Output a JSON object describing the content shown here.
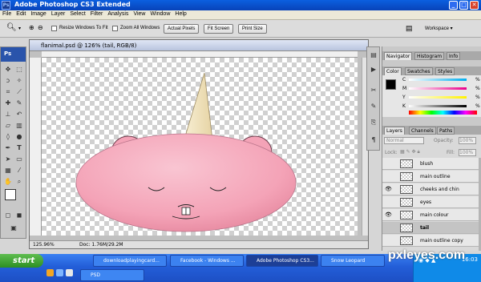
{
  "window": {
    "app_icon_text": "Ps",
    "title": "Adobe Photoshop CS3 Extended",
    "controls": [
      "_",
      "□",
      "✕"
    ]
  },
  "menubar": {
    "items": [
      "File",
      "Edit",
      "Image",
      "Layer",
      "Select",
      "Filter",
      "Analysis",
      "View",
      "Window",
      "Help"
    ]
  },
  "options": {
    "resize_windows_label": "Resize Windows To Fit",
    "zoom_all_label": "Zoom All Windows",
    "actual_pixels": "Actual Pixels",
    "fit_screen": "Fit Screen",
    "print_size": "Print Size",
    "workspace": "Workspace ▾"
  },
  "toolbox": {
    "header": "Ps"
  },
  "document": {
    "title": "flanimal.psd @ 126% (tail, RGB/8)",
    "zoom": "125.96%",
    "doc_info": "Doc: 1.76M/29.2M"
  },
  "panels": {
    "top_tabs": [
      "Navigator",
      "Histogram",
      "Info"
    ],
    "color_tabs": [
      "Color",
      "Swatches",
      "Styles"
    ],
    "color_channels": [
      "C",
      "M",
      "Y",
      "K"
    ],
    "percent": "%",
    "layers_tabs": [
      "Layers",
      "Channels",
      "Paths"
    ],
    "blend_mode": "Normal",
    "opacity_label": "Opacity:",
    "opacity": "100%",
    "lock_label": "Lock:",
    "fill_label": "Fill:",
    "fill": "100%",
    "layers": [
      "blush",
      "main outline",
      "cheeks and chin",
      "eyes",
      "main colour",
      "tail",
      "main outline copy"
    ],
    "layer_visible": [
      false,
      false,
      true,
      false,
      true,
      false,
      false
    ],
    "selected_layer_index": 5
  },
  "taskbar": {
    "start": "start",
    "tasks": [
      "downloadplayingcard...",
      "Facebook - Windows ...",
      "Adobe Photoshop CS3...",
      "Snow Leopard"
    ],
    "active_task_index": 2,
    "folder_task": "PSD",
    "clock": "16:03"
  },
  "watermark": "pxleyes.com",
  "colors": {
    "accent": "#0b5fe0",
    "body_pink": "#f4a3b7",
    "ear_pink": "#e0217f",
    "horn": "#f3e7c3"
  }
}
